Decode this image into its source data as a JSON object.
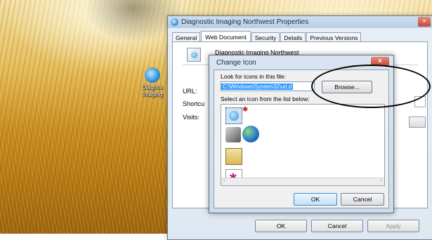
{
  "desktop": {
    "icon_label_line1": "Diagnos",
    "icon_label_line2": "Imaging"
  },
  "properties_window": {
    "title": "Diagnostic Imaging Northwest Properties",
    "close_glyph": "×",
    "tabs": [
      "General",
      "Web Document",
      "Security",
      "Details",
      "Previous Versions"
    ],
    "active_tab": "Web Document",
    "document_name": "Diagnostic Imaging Northwest",
    "field_labels": {
      "url": "URL:",
      "shortcut": "Shortcu",
      "visits": "Visits:"
    },
    "buttons": {
      "ok": "OK",
      "cancel": "Cancel",
      "apply": "Apply"
    }
  },
  "change_icon_dialog": {
    "title": "Change Icon",
    "close_glyph": "×",
    "look_label": "Look for icons in this file:",
    "path_value": "C:\\Windows\\System32\\url.d",
    "browse_label": "Browse...",
    "select_label": "Select an icon from the list below:",
    "icons": [
      "internet-explorer-icon",
      "red-star-icon",
      "phone-fax-icon",
      "globe-icon",
      "envelope-icon",
      "colorful-chart-icon"
    ],
    "scroll_left": "‹",
    "scroll_right": "›",
    "ok_label": "OK",
    "cancel_label": "Cancel"
  },
  "colors": {
    "dialog_bg": "#d9e5f1",
    "selection": "#3399ff",
    "close_red": "#c24a33"
  }
}
